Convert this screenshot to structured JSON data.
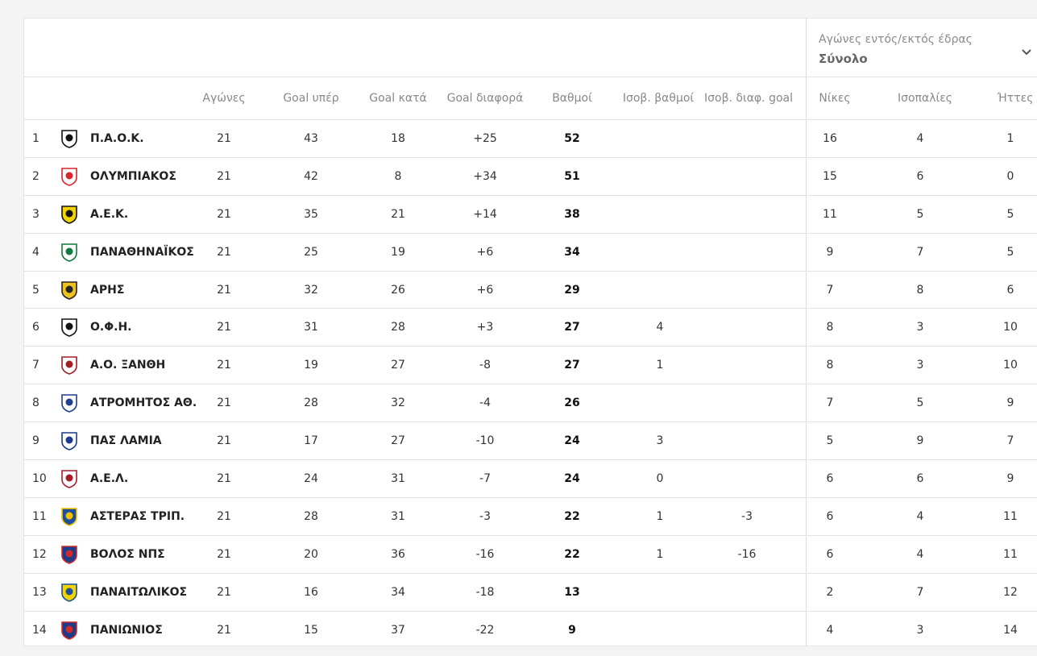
{
  "filter": {
    "label": "Αγώνες εντός/εκτός έδρας",
    "value": "Σύνολο"
  },
  "headers": {
    "played": "Αγώνες",
    "goals_for": "Goal υπέρ",
    "goals_against": "Goal κατά",
    "goal_diff": "Goal διαφορά",
    "points": "Βαθμοί",
    "tie_points": "Ισοβ. βαθμοί",
    "tie_goal_diff": "Ισοβ. διαφ. goal",
    "wins": "Νίκες",
    "draws": "Ισοπαλίες",
    "losses": "Ήττες"
  },
  "colors": {
    "border": "#e3e3e3",
    "header_text": "#888888",
    "body_text": "#333333"
  },
  "rows": [
    {
      "pos": "1",
      "team": "Π.Α.Ο.Κ.",
      "logo": "paok-crest-icon",
      "played": "21",
      "gf": "43",
      "ga": "18",
      "gd": "+25",
      "pts": "52",
      "tp": "",
      "tgd": "",
      "w": "16",
      "d": "4",
      "l": "1",
      "logo_color": "#111111",
      "logo_bg": "#ffffff"
    },
    {
      "pos": "2",
      "team": "ΟΛΥΜΠΙΑΚΟΣ",
      "logo": "olympiacos-crest-icon",
      "played": "21",
      "gf": "42",
      "ga": "8",
      "gd": "+34",
      "pts": "51",
      "tp": "",
      "tgd": "",
      "w": "15",
      "d": "6",
      "l": "0",
      "logo_color": "#d7262e",
      "logo_bg": "#ffffff"
    },
    {
      "pos": "3",
      "team": "Α.Ε.Κ.",
      "logo": "aek-crest-icon",
      "played": "21",
      "gf": "35",
      "ga": "21",
      "gd": "+14",
      "pts": "38",
      "tp": "",
      "tgd": "",
      "w": "11",
      "d": "5",
      "l": "5",
      "logo_color": "#111111",
      "logo_bg": "#f2d200"
    },
    {
      "pos": "4",
      "team": "ΠΑΝΑΘΗΝΑΪΚΟΣ",
      "logo": "panathinaikos-crest-icon",
      "played": "21",
      "gf": "25",
      "ga": "19",
      "gd": "+6",
      "pts": "34",
      "tp": "",
      "tgd": "",
      "w": "9",
      "d": "7",
      "l": "5",
      "logo_color": "#0e7a3c",
      "logo_bg": "#ffffff"
    },
    {
      "pos": "5",
      "team": "ΑΡΗΣ",
      "logo": "aris-crest-icon",
      "played": "21",
      "gf": "32",
      "ga": "26",
      "gd": "+6",
      "pts": "29",
      "tp": "",
      "tgd": "",
      "w": "7",
      "d": "8",
      "l": "6",
      "logo_color": "#222222",
      "logo_bg": "#f0c020"
    },
    {
      "pos": "6",
      "team": "Ο.Φ.Η.",
      "logo": "ofi-crest-icon",
      "played": "21",
      "gf": "31",
      "ga": "28",
      "gd": "+3",
      "pts": "27",
      "tp": "4",
      "tgd": "",
      "w": "8",
      "d": "3",
      "l": "10",
      "logo_color": "#111111",
      "logo_bg": "#ffffff"
    },
    {
      "pos": "7",
      "team": "Α.Ο. ΞΑΝΘΗ",
      "logo": "xanthi-crest-icon",
      "played": "21",
      "gf": "19",
      "ga": "27",
      "gd": "-8",
      "pts": "27",
      "tp": "1",
      "tgd": "",
      "w": "8",
      "d": "3",
      "l": "10",
      "logo_color": "#a01e28",
      "logo_bg": "#ffffff"
    },
    {
      "pos": "8",
      "team": "ΑΤΡΟΜΗΤΟΣ ΑΘ.",
      "logo": "atromitos-crest-icon",
      "played": "21",
      "gf": "28",
      "ga": "32",
      "gd": "-4",
      "pts": "26",
      "tp": "",
      "tgd": "",
      "w": "7",
      "d": "5",
      "l": "9",
      "logo_color": "#1f3f8f",
      "logo_bg": "#ffffff"
    },
    {
      "pos": "9",
      "team": "ΠΑΣ ΛΑΜΙΑ",
      "logo": "lamia-crest-icon",
      "played": "21",
      "gf": "17",
      "ga": "27",
      "gd": "-10",
      "pts": "24",
      "tp": "3",
      "tgd": "",
      "w": "5",
      "d": "9",
      "l": "7",
      "logo_color": "#1b3a8c",
      "logo_bg": "#ffffff"
    },
    {
      "pos": "10",
      "team": "Α.Ε.Λ.",
      "logo": "ael-crest-icon",
      "played": "21",
      "gf": "24",
      "ga": "31",
      "gd": "-7",
      "pts": "24",
      "tp": "0",
      "tgd": "",
      "w": "6",
      "d": "6",
      "l": "9",
      "logo_color": "#a51d2d",
      "logo_bg": "#ffffff"
    },
    {
      "pos": "11",
      "team": "ΑΣΤΕΡΑΣ ΤΡΙΠ.",
      "logo": "asteras-crest-icon",
      "played": "21",
      "gf": "28",
      "ga": "31",
      "gd": "-3",
      "pts": "22",
      "tp": "1",
      "tgd": "-3",
      "w": "6",
      "d": "4",
      "l": "11",
      "logo_color": "#f3c300",
      "logo_bg": "#1d4f9c"
    },
    {
      "pos": "12",
      "team": "ΒΟΛΟΣ ΝΠΣ",
      "logo": "volos-crest-icon",
      "played": "21",
      "gf": "20",
      "ga": "36",
      "gd": "-16",
      "pts": "22",
      "tp": "1",
      "tgd": "-16",
      "w": "6",
      "d": "4",
      "l": "11",
      "logo_color": "#d02a2a",
      "logo_bg": "#1d3c8a"
    },
    {
      "pos": "13",
      "team": "ΠΑΝΑΙΤΩΛΙΚΟΣ",
      "logo": "panetolikos-crest-icon",
      "played": "21",
      "gf": "16",
      "ga": "34",
      "gd": "-18",
      "pts": "13",
      "tp": "",
      "tgd": "",
      "w": "2",
      "d": "7",
      "l": "12",
      "logo_color": "#1d4f9c",
      "logo_bg": "#f3d400"
    },
    {
      "pos": "14",
      "team": "ΠΑΝΙΩΝΙΟΣ",
      "logo": "panionios-crest-icon",
      "played": "21",
      "gf": "15",
      "ga": "37",
      "gd": "-22",
      "pts": "9",
      "tp": "",
      "tgd": "",
      "w": "4",
      "d": "3",
      "l": "14",
      "logo_color": "#d02a2a",
      "logo_bg": "#1d3c8a"
    }
  ]
}
